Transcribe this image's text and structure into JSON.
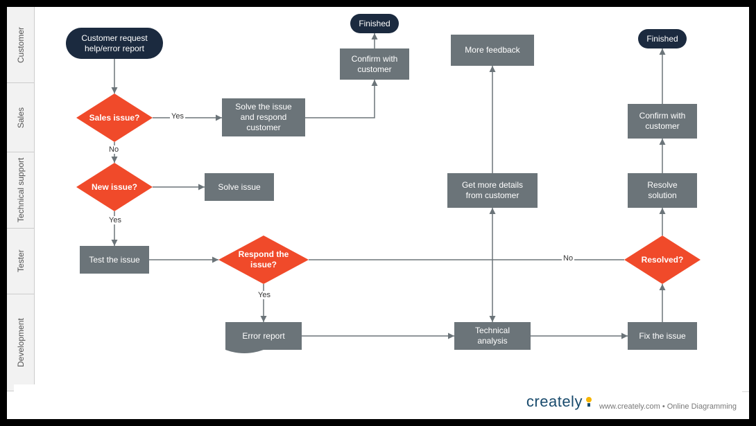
{
  "lanes": {
    "customer": "Customer",
    "sales": "Sales",
    "tech_support": "Technical support",
    "tester": "Tester",
    "development": "Development"
  },
  "boundaries": {
    "h0": 0,
    "h1": 110,
    "h2": 210,
    "h3": 320,
    "h4": 415,
    "h5": 555
  },
  "nodes": {
    "start": "Customer request help/error report",
    "sales_issue": "Sales issue?",
    "solve_respond": "Solve the issue and respond customer",
    "confirm_customer_1": "Confirm with customer",
    "finished_1": "Finished",
    "more_feedback": "More feedback",
    "new_issue": "New issue?",
    "solve_issue": "Solve issue",
    "get_details": "Get more details from customer",
    "resolve_solution": "Resolve solution",
    "test_issue": "Test the issue",
    "respond_issue": "Respond the issue?",
    "resolved": "Resolved?",
    "error_report": "Error report",
    "technical_analysis": "Technical analysis",
    "fix_issue": "Fix the issue",
    "confirm_customer_2": "Confirm with customer",
    "finished_2": "Finished"
  },
  "labels": {
    "yes": "Yes",
    "no": "No"
  },
  "footer": {
    "brand": "creately",
    "tagline": "www.creately.com • Online Diagramming"
  },
  "colors": {
    "box": "#6b7479",
    "decision": "#f04a2a",
    "terminal": "#1b2a3f",
    "arrow": "#6b7479"
  }
}
